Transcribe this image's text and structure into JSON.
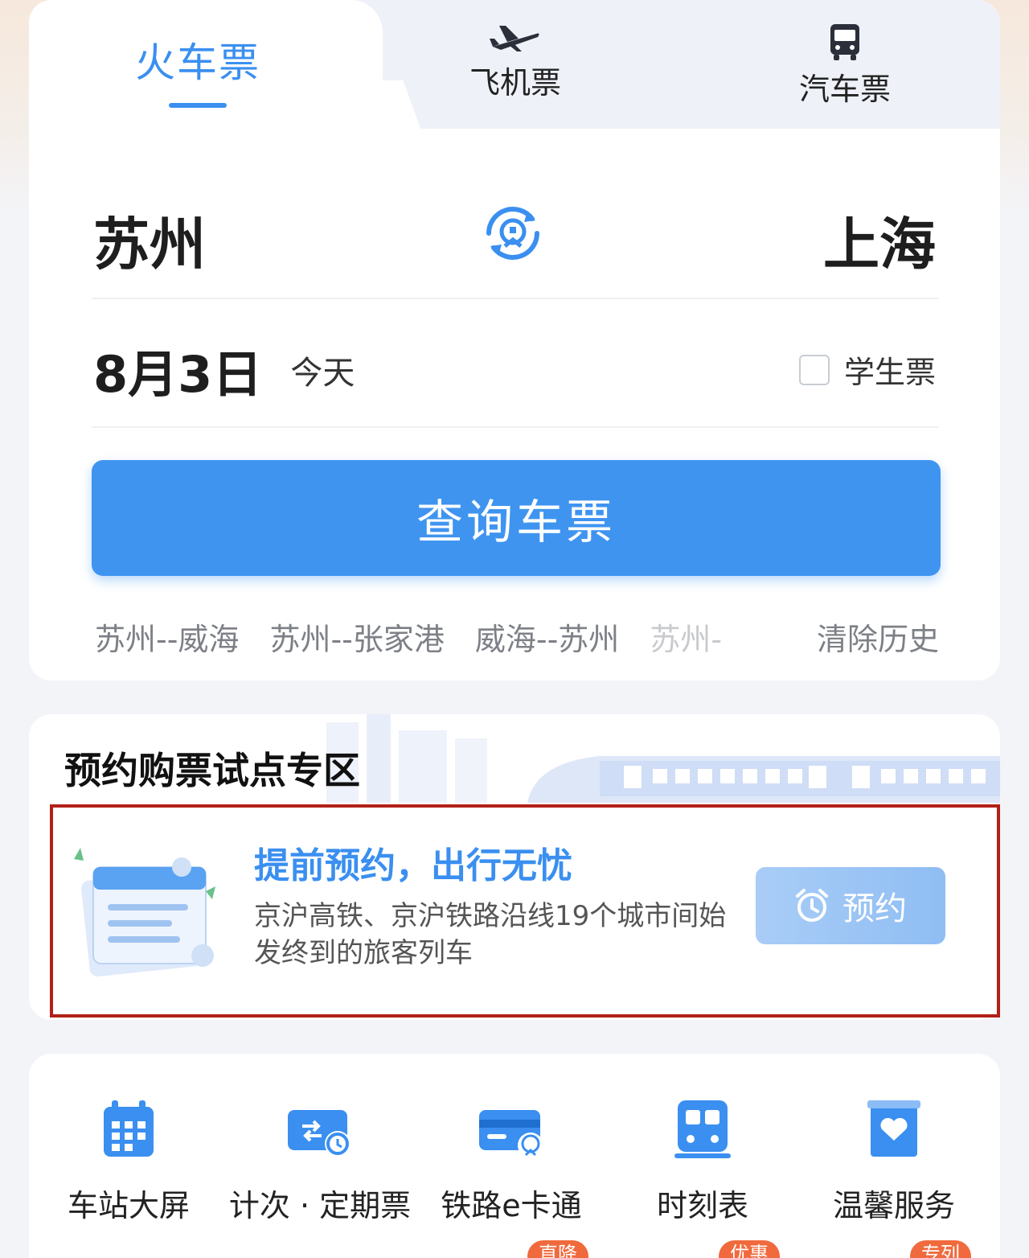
{
  "tabs": {
    "train": "火车票",
    "plane": "飞机票",
    "bus": "汽车票"
  },
  "route": {
    "from": "苏州",
    "to": "上海"
  },
  "date": {
    "main": "8月3日",
    "sub": "今天"
  },
  "student": {
    "label": "学生票",
    "checked": false
  },
  "search": {
    "label": "查询车票"
  },
  "history": {
    "items": [
      "苏州--威海",
      "苏州--张家港",
      "威海--苏州",
      "苏州-"
    ],
    "clear": "清除历史"
  },
  "reservation": {
    "section_title": "预约购票试点专区",
    "headline": "提前预约，出行无忧",
    "description": "京沪高铁、京沪铁路沿线19个城市间始发终到的旅客列车",
    "button": "预约"
  },
  "services": [
    {
      "label": "车站大屏",
      "icon": "calendar-icon"
    },
    {
      "label": "计次 · 定期票",
      "icon": "ticket-card-icon"
    },
    {
      "label": "铁路e卡通",
      "icon": "rail-card-icon"
    },
    {
      "label": "时刻表",
      "icon": "train-front-icon"
    },
    {
      "label": "温馨服务",
      "icon": "heart-box-icon"
    }
  ],
  "badges": [
    "直降",
    "优惠",
    "专列"
  ],
  "colors": {
    "accent": "#3a8ff0",
    "button": "#3f94f0",
    "highlight_border": "#b22017",
    "badge": "#f06a3d"
  }
}
